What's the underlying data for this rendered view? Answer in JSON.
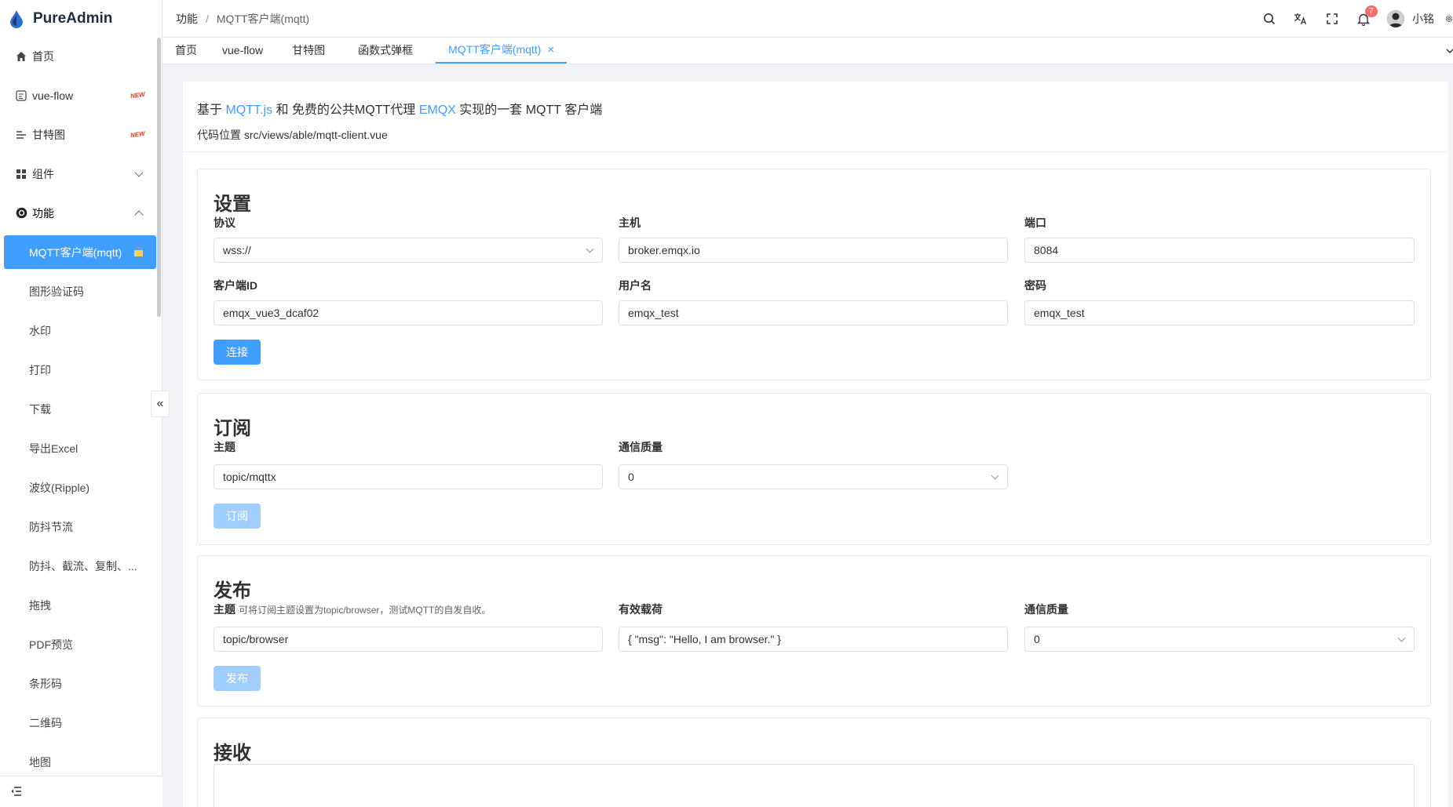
{
  "app": {
    "name": "PureAdmin"
  },
  "sidebar": {
    "items": [
      {
        "label": "首页",
        "icon": "home-icon"
      },
      {
        "label": "vue-flow",
        "icon": "flow-icon",
        "badge": "NEW"
      },
      {
        "label": "甘特图",
        "icon": "gantt-icon",
        "badge": "NEW"
      },
      {
        "label": "组件",
        "icon": "grid-icon"
      },
      {
        "label": "功能",
        "icon": "settings-circle-icon"
      }
    ],
    "sub_items": [
      "MQTT客户端(mqtt)",
      "图形验证码",
      "水印",
      "打印",
      "下载",
      "导出Excel",
      "波纹(Ripple)",
      "防抖节流",
      "防抖、截流、复制、...",
      "拖拽",
      "PDF预览",
      "条形码",
      "二维码",
      "地图"
    ]
  },
  "breadcrumb": {
    "parent": "功能",
    "separator": "/",
    "current": "MQTT客户端(mqtt)"
  },
  "header": {
    "notifications": "7",
    "user": "小铭"
  },
  "tabs": [
    "首页",
    "vue-flow",
    "甘特图",
    "函数式弹框",
    "MQTT客户端(mqtt)"
  ],
  "intro": {
    "prefix": "基于",
    "link1": "MQTT.js",
    "middle": "和 免费的公共MQTT代理",
    "link2": "EMQX",
    "suffix": "实现的一套 MQTT 客户端",
    "path": "代码位置 src/views/able/mqtt-client.vue"
  },
  "settings": {
    "title": "设置",
    "protocol_label": "协议",
    "protocol_value": "wss://",
    "host_label": "主机",
    "host_value": "broker.emqx.io",
    "port_label": "端口",
    "port_value": "8084",
    "clientid_label": "客户端ID",
    "clientid_value": "emqx_vue3_dcaf02",
    "username_label": "用户名",
    "username_value": "emqx_test",
    "password_label": "密码",
    "password_value": "emqx_test",
    "connect_label": "连接"
  },
  "subscribe": {
    "title": "订阅",
    "topic_label": "主题",
    "topic_value": "topic/mqttx",
    "qos_label": "通信质量",
    "qos_value": "0",
    "button_label": "订阅"
  },
  "publish": {
    "title": "发布",
    "topic_label": "主题",
    "topic_hint": "可将订阅主题设置为topic/browser，测试MQTT的自发自收。",
    "topic_value": "topic/browser",
    "payload_label": "有效载荷",
    "payload_value": "{ \"msg\": \"Hello, I am browser.\" }",
    "qos_label": "通信质量",
    "qos_value": "0",
    "button_label": "发布"
  },
  "receive": {
    "title": "接收"
  },
  "colors": {
    "primary": "#409eff",
    "primary_disabled": "#a0cfff",
    "badge": "#f56c6c"
  }
}
